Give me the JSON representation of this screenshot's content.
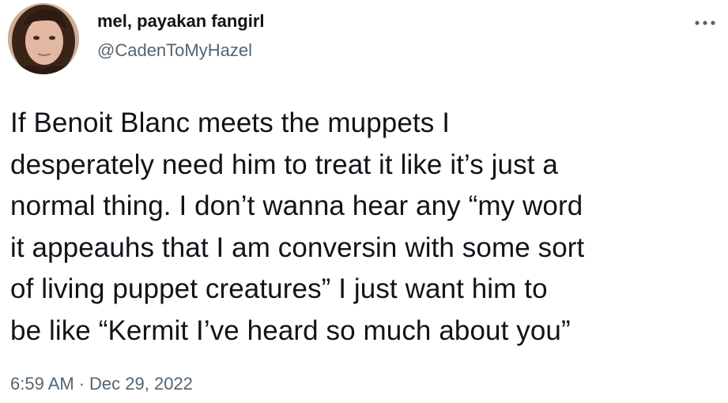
{
  "author": {
    "display_name": "mel, payakan fangirl",
    "handle": "@CadenToMyHazel"
  },
  "tweet": {
    "text": "If Benoit Blanc meets the muppets I\ndesperately need him to treat it like it’s just a\nnormal thing. I don’t wanna hear any “my word\nit appeauhs that I am conversin with some sort\nof living puppet creatures” I just want him to\nbe like “Kermit I’ve heard so much about you”",
    "time": "6:59 AM",
    "separator": "·",
    "date": "Dec 29, 2022"
  },
  "icons": {
    "more": "more-horizontal-icon"
  },
  "colors": {
    "text_primary": "#0f1419",
    "text_secondary": "#536471",
    "background": "#ffffff"
  }
}
